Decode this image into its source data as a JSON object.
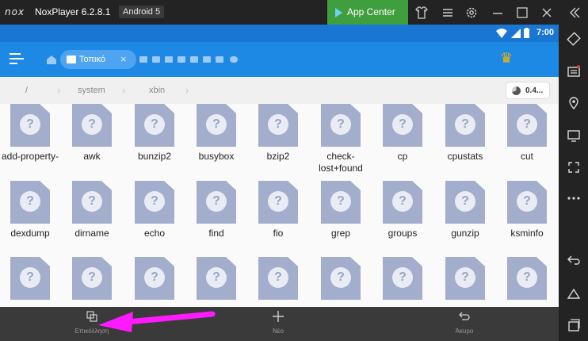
{
  "window": {
    "logo": "nox",
    "title": "NoxPlayer 6.2.8.1",
    "android_badge": "Android 5",
    "app_center_label": "App Center"
  },
  "status_bar": {
    "time": "7:00"
  },
  "app_bar": {
    "local_tab_label": "Τοπικό"
  },
  "breadcrumb": {
    "root": "/",
    "items": [
      "system",
      "xbin"
    ],
    "storage": "0.4..."
  },
  "files": [
    {
      "name": "add-property-"
    },
    {
      "name": "awk"
    },
    {
      "name": "bunzip2"
    },
    {
      "name": "busybox"
    },
    {
      "name": "bzip2"
    },
    {
      "name": "check-lost+found"
    },
    {
      "name": "cp"
    },
    {
      "name": "cpustats"
    },
    {
      "name": "cut"
    },
    {
      "name": "dexdump"
    },
    {
      "name": "dirname"
    },
    {
      "name": "echo"
    },
    {
      "name": "find"
    },
    {
      "name": "fio"
    },
    {
      "name": "grep"
    },
    {
      "name": "groups"
    },
    {
      "name": "gunzip"
    },
    {
      "name": "ksminfo"
    },
    {
      "name": ""
    },
    {
      "name": ""
    },
    {
      "name": ""
    },
    {
      "name": ""
    },
    {
      "name": ""
    },
    {
      "name": ""
    },
    {
      "name": ""
    },
    {
      "name": ""
    },
    {
      "name": ""
    }
  ],
  "actions": {
    "paste": "Επικόλληση",
    "new": "Νέο",
    "cancel": "Άκυρο"
  },
  "colors": {
    "appbar": "#1e88e5",
    "status": "#1976d2",
    "app_center": "#3f9f3f",
    "annotation_arrow": "#ff1aff"
  }
}
